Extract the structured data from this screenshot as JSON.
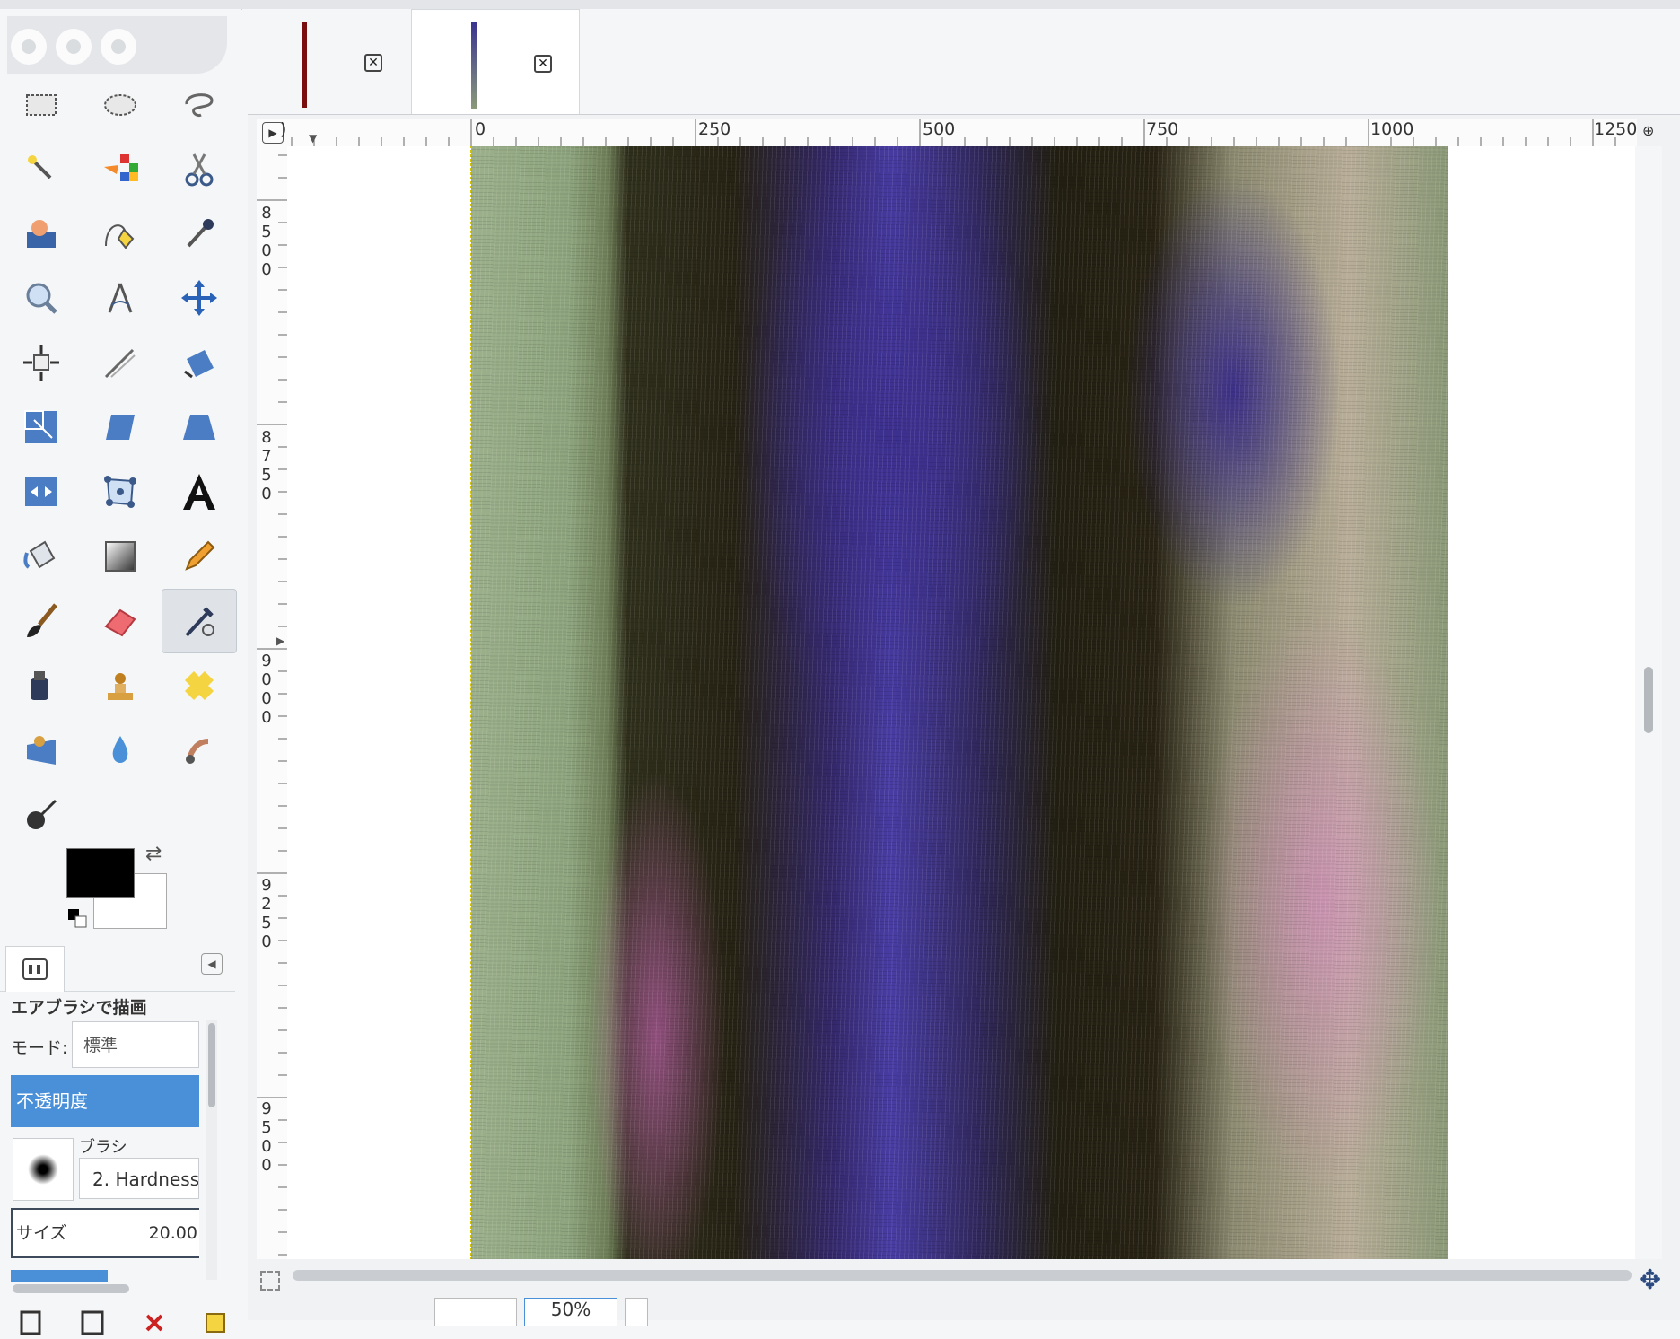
{
  "colors": {
    "accent": "#4a90d9",
    "foreground_color": "#000000",
    "background_color": "#ffffff"
  },
  "tabs": [
    {
      "thumb_color": "#7a0d0d",
      "close_icon": "close-icon"
    },
    {
      "thumb_color": "#6b6aa8",
      "close_icon": "close-icon",
      "active": true
    }
  ],
  "tools": [
    {
      "name": "rect-select-icon"
    },
    {
      "name": "ellipse-select-icon"
    },
    {
      "name": "free-select-icon"
    },
    {
      "name": "fuzzy-select-icon"
    },
    {
      "name": "color-select-icon"
    },
    {
      "name": "scissors-icon"
    },
    {
      "name": "foreground-select-icon"
    },
    {
      "name": "paths-icon"
    },
    {
      "name": "color-picker-icon"
    },
    {
      "name": "zoom-icon"
    },
    {
      "name": "measure-icon"
    },
    {
      "name": "move-icon"
    },
    {
      "name": "align-icon"
    },
    {
      "name": "crop-icon"
    },
    {
      "name": "rotate-icon"
    },
    {
      "name": "scale-icon"
    },
    {
      "name": "shear-icon"
    },
    {
      "name": "perspective-icon"
    },
    {
      "name": "flip-icon"
    },
    {
      "name": "cage-transform-icon"
    },
    {
      "name": "text-icon"
    },
    {
      "name": "bucket-fill-icon"
    },
    {
      "name": "gradient-icon"
    },
    {
      "name": "pencil-icon"
    },
    {
      "name": "paintbrush-icon"
    },
    {
      "name": "eraser-icon"
    },
    {
      "name": "airbrush-icon",
      "active": true
    },
    {
      "name": "ink-icon"
    },
    {
      "name": "clone-icon"
    },
    {
      "name": "heal-icon"
    },
    {
      "name": "perspective-clone-icon"
    },
    {
      "name": "blur-icon"
    },
    {
      "name": "smudge-icon"
    },
    {
      "name": "dodge-burn-icon"
    }
  ],
  "tool_options": {
    "title": "エアブラシで描画",
    "mode_label": "モード:",
    "mode_value": "標準",
    "opacity_label": "不透明度",
    "brush_label": "ブラシ",
    "brush_name": "2. Hardness",
    "size_label": "サイズ",
    "size_value": "20.00"
  },
  "rulers": {
    "horizontal": [
      "0",
      "250",
      "500",
      "750",
      "1000",
      "1250"
    ],
    "vertical": [
      "8500",
      "8750",
      "9000",
      "9250",
      "9500"
    ],
    "h_left_label": ")"
  },
  "status": {
    "zoom": "50%"
  }
}
